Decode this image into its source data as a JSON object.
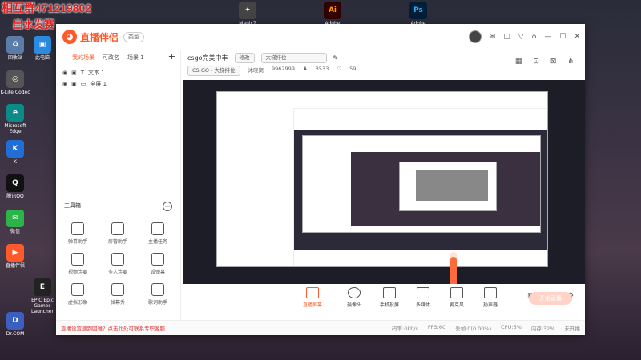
{
  "overlay": {
    "line1": "相互群471219802",
    "line2": "出水发赛"
  },
  "desktop_top": [
    {
      "label": "Manic7",
      "icon": "app-icon"
    },
    {
      "label": "Adobe",
      "icon": "ai-icon",
      "glyph": "Ai",
      "color": "#ff9a00"
    },
    {
      "label": "Adobe",
      "icon": "ps-icon",
      "glyph": "Ps",
      "color": "#31a8ff"
    }
  ],
  "desktop_left": [
    {
      "label": "回收站",
      "icon": "recycle-bin-icon"
    },
    {
      "label": "此电脑",
      "icon": "computer-icon"
    },
    {
      "label": "K-Lite Codec",
      "icon": "codec-icon"
    },
    {
      "label": "Microsoft Edge",
      "icon": "edge-icon"
    },
    {
      "label": "K",
      "icon": "k-icon"
    },
    {
      "label": "腾讯QQ",
      "icon": "qq-icon"
    },
    {
      "label": "微信",
      "icon": "wechat-icon"
    },
    {
      "label": "直播伴侣",
      "icon": "live-icon"
    },
    {
      "label": "EPIC Epic Games Launcher",
      "icon": "epic-icon"
    },
    {
      "label": "Dr.COM",
      "icon": "drcom-icon"
    }
  ],
  "titlebar": {
    "brand": "直播伴侣",
    "brand_tag": "类型",
    "icons": [
      "avatar",
      "mail-icon",
      "square-icon",
      "filter-icon",
      "shirt-icon",
      "minimize-icon",
      "maximize-icon",
      "close-icon"
    ]
  },
  "left": {
    "tabs": [
      "我的场景",
      "可改名",
      "场景 1"
    ],
    "plus": "+",
    "sources": [
      "文本 1",
      "全屏 1"
    ],
    "tools_title": "工具箱",
    "tools": [
      "弹幕助手",
      "房管助手",
      "主播任务",
      "视频连麦",
      "多人连麦",
      "设弹幕",
      "虚拟形象",
      "弹幕秀",
      "歌词助手"
    ]
  },
  "info": {
    "stream_title": "csgo完美中丰",
    "edit_label": "修改",
    "category": "大梯排位",
    "game": "CS:GO - 大梯排位",
    "streamer_prefix": "沐晓窝",
    "room_id": "9962999",
    "viewers": "3533",
    "likes": "59"
  },
  "bottom": {
    "tools": [
      "直播屏幕",
      "摄像头",
      "手机投屏",
      "多媒体",
      "麦克风",
      "扬声器"
    ],
    "mic_level": "100",
    "go_live": "开始直播"
  },
  "status": {
    "notice": "直播设置遇到困难？点击此处可联系专职客服",
    "bitrate": "码率:0kb/s",
    "fps": "FPS:60",
    "dropped": "丢帧:0(0.00%)",
    "cpu": "CPU:6%",
    "memory": "内存:32%",
    "connection": "未开播"
  },
  "colors": {
    "accent": "#ff5a2c",
    "golive": "#ffd4c6"
  }
}
